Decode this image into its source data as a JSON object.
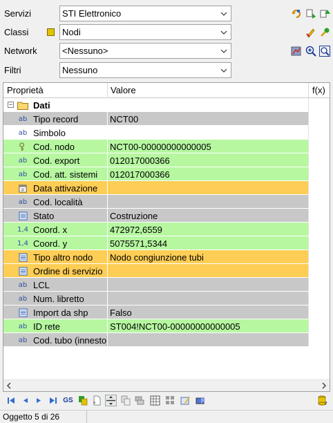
{
  "form": {
    "servizi": {
      "label": "Servizi",
      "value": "STI Elettronico"
    },
    "classi": {
      "label": "Classi",
      "value": "Nodi"
    },
    "network": {
      "label": "Network",
      "value": "<Nessuno>"
    },
    "filtri": {
      "label": "Filtri",
      "value": "Nessuno"
    }
  },
  "grid": {
    "headers": {
      "prop": "Proprietà",
      "value": "Valore",
      "fx": "f(x)"
    },
    "group": {
      "toggle": "−",
      "label": "Dati"
    },
    "rows": [
      {
        "icon": "ab",
        "label": "Tipo record",
        "value": "NCT00",
        "color": "gray"
      },
      {
        "icon": "ab",
        "label": "Simbolo",
        "value": "",
        "color": "white"
      },
      {
        "icon": "key",
        "label": "Cod. nodo",
        "value": "NCT00-00000000000005",
        "color": "green"
      },
      {
        "icon": "ab",
        "label": "Cod. export",
        "value": "012017000366",
        "color": "green"
      },
      {
        "icon": "ab",
        "label": "Cod. att. sistemi",
        "value": "012017000366",
        "color": "green"
      },
      {
        "icon": "calendar",
        "label": "Data attivazione",
        "value": "",
        "color": "orange"
      },
      {
        "icon": "ab",
        "label": "Cod. località",
        "value": "",
        "color": "gray"
      },
      {
        "icon": "list",
        "label": "Stato",
        "value": "Costruzione",
        "color": "gray"
      },
      {
        "icon": "1.4",
        "label": "Coord. x",
        "value": "472972,6559",
        "color": "green"
      },
      {
        "icon": "1.4",
        "label": "Coord. y",
        "value": "5075571,5344",
        "color": "green"
      },
      {
        "icon": "list",
        "label": "Tipo altro nodo",
        "value": "Nodo congiunzione tubi",
        "color": "orange"
      },
      {
        "icon": "list",
        "label": "Ordine di servizio",
        "value": "",
        "color": "orange"
      },
      {
        "icon": "ab",
        "label": "LCL",
        "value": "",
        "color": "gray"
      },
      {
        "icon": "ab",
        "label": "Num. libretto",
        "value": "",
        "color": "gray"
      },
      {
        "icon": "list",
        "label": "Import da shp",
        "value": "Falso",
        "color": "gray"
      },
      {
        "icon": "ab",
        "label": "ID rete",
        "value": "ST004!NCT00-00000000000005",
        "color": "green"
      },
      {
        "icon": "ab",
        "label": "Cod. tubo (innesto)",
        "value": "",
        "color": "gray"
      }
    ]
  },
  "nav": {
    "gs_label": "GS"
  },
  "status": {
    "text": "Oggetto 5 di 26"
  },
  "colors": {
    "gray": "#c8c8c8",
    "green": "#b6f7a0",
    "orange": "#fdcd55",
    "white": "#ffffff"
  }
}
